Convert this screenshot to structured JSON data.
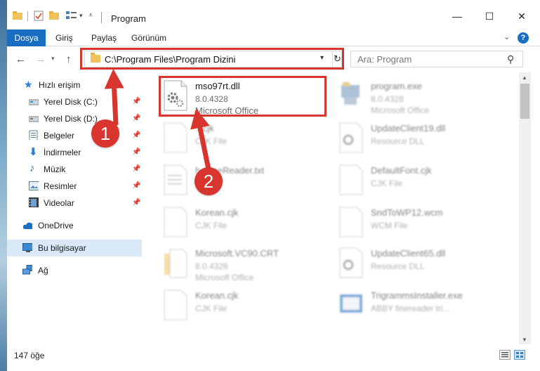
{
  "window": {
    "title": "Program",
    "minimize_glyph": "—",
    "maximize_glyph": "☐",
    "close_glyph": "✕"
  },
  "ribbon": {
    "tabs": [
      {
        "label": "Dosya",
        "active": true
      },
      {
        "label": "Giriş"
      },
      {
        "label": "Paylaş"
      },
      {
        "label": "Görünüm"
      }
    ],
    "help_glyph": "?"
  },
  "address": {
    "path": "C:\\Program Files\\Program Dizini",
    "search_placeholder": "Ara: Program"
  },
  "sidebar": {
    "items": [
      {
        "label": "Hızlı erişim",
        "icon": "star-icon",
        "pinned": false
      },
      {
        "label": "Yerel Disk (C:)",
        "icon": "drive-icon",
        "pinned": true
      },
      {
        "label": "Yerel Disk (D:)",
        "icon": "drive-icon",
        "pinned": true
      },
      {
        "label": "Belgeler",
        "icon": "documents-icon",
        "pinned": true
      },
      {
        "label": "İndirmeler",
        "icon": "download-icon",
        "pinned": true
      },
      {
        "label": "Müzik",
        "icon": "music-icon",
        "pinned": true
      },
      {
        "label": "Resimler",
        "icon": "pictures-icon",
        "pinned": true
      },
      {
        "label": "Videolar",
        "icon": "video-icon",
        "pinned": true
      },
      {
        "label": "OneDrive",
        "icon": "cloud-icon",
        "pinned": false
      },
      {
        "label": "Bu bilgisayar",
        "icon": "computer-icon",
        "pinned": false,
        "selected": true
      },
      {
        "label": "Ağ",
        "icon": "network-icon",
        "pinned": false
      }
    ]
  },
  "files": [
    {
      "name": "mso97rt.dll",
      "line1": "8.0.4328",
      "line2": "Microsoft Office",
      "icon": "dll-gear-icon",
      "highlighted": true
    },
    {
      "name": "program.exe",
      "line1": "8.0.4328",
      "line2": "Microsoft Office",
      "icon": "exe-icon"
    },
    {
      "name": "...cjk",
      "line1": "CJK File",
      "line2": "",
      "icon": "blank-file-icon"
    },
    {
      "name": "UpdateClient19.dll",
      "line1": "Resource DLL",
      "line2": "",
      "icon": "dll-gear-icon"
    },
    {
      "name": "h...fineReader.txt",
      "line1": "",
      "line2": "",
      "icon": "text-file-icon"
    },
    {
      "name": "DefaultFont.cjk",
      "line1": "CJK File",
      "line2": "",
      "icon": "blank-file-icon"
    },
    {
      "name": "Korean.cjk",
      "line1": "CJK File",
      "line2": "",
      "icon": "blank-file-icon"
    },
    {
      "name": "SndToWP12.wcm",
      "line1": "WCM File",
      "line2": "",
      "icon": "blank-file-icon"
    },
    {
      "name": "Microsoft.VC90.CRT",
      "line1": "8.0.4328",
      "line2": "Microsoft Office",
      "icon": "folder-file-icon"
    },
    {
      "name": "UpdateClient65.dll",
      "line1": "Resource DLL",
      "line2": "",
      "icon": "dll-gear-icon"
    },
    {
      "name": "Korean.cjk",
      "line1": "CJK File",
      "line2": "",
      "icon": "blank-file-icon"
    },
    {
      "name": "TrigrammsInstaller.exe",
      "line1": "ABBY finereader tri...",
      "line2": "",
      "icon": "installer-icon"
    }
  ],
  "status": {
    "item_count": "147 öğe"
  },
  "annotations": {
    "badge1": "1",
    "badge2": "2"
  },
  "colors": {
    "accent": "#1a6ec2",
    "annotation_red": "#d9352f",
    "selection": "#d9e9f7"
  }
}
